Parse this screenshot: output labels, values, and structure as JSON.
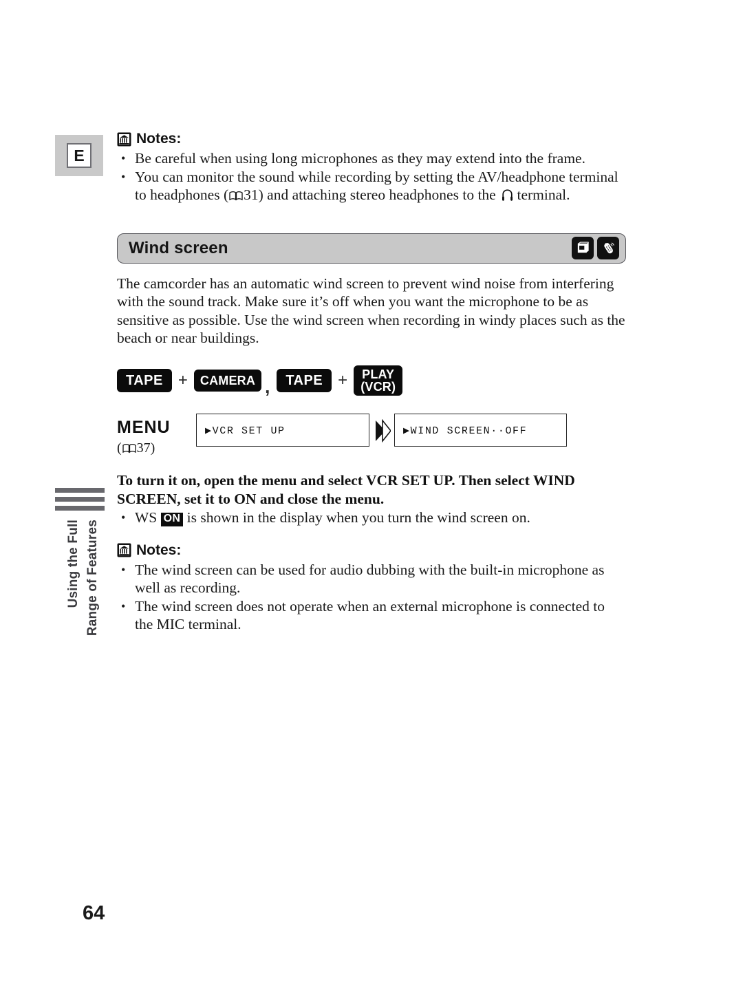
{
  "page": {
    "number": "64",
    "side_tab_letter": "E",
    "side_label_line1": "Using the Full",
    "side_label_line2": "Range of Features"
  },
  "notes_top": {
    "icon": "book-note-icon",
    "heading": "Notes:",
    "bullets": [
      {
        "parts": [
          {
            "type": "text",
            "value": "Be careful when using long microphones as they may extend into the frame."
          }
        ]
      },
      {
        "parts": [
          {
            "type": "text",
            "value": "You can monitor the sound while recording by setting the AV/headphone terminal to headphones ("
          },
          {
            "type": "pageref",
            "value": "31"
          },
          {
            "type": "text",
            "value": ") and attaching stereo headphones to the "
          },
          {
            "type": "headphone-symbol",
            "value": ""
          },
          {
            "type": "text",
            "value": " terminal."
          }
        ]
      }
    ]
  },
  "section": {
    "title": "Wind screen",
    "mode_icons": [
      {
        "name": "tape-cassette-icon",
        "label": "TAPE"
      },
      {
        "name": "remote-control-icon",
        "label": "REMOTE"
      }
    ],
    "body": "The camcorder has an automatic wind screen to prevent wind noise from interfering with the sound track. Make sure it’s off when you want the microphone to be as sensitive as possible. Use the wind screen when recording in windy places such as the beach or near buildings."
  },
  "mode_chips": {
    "group1": {
      "left": "TAPE",
      "plus": "+",
      "right": "CAMERA"
    },
    "separator": ",",
    "group2": {
      "left": "TAPE",
      "plus": "+",
      "right_line1": "PLAY",
      "right_line2": "(VCR)"
    }
  },
  "menu_flow": {
    "label": "MENU",
    "ref_open": "(",
    "ref_page": "37",
    "ref_close": ")",
    "step1": "▶VCR SET UP",
    "step2": "▶WIND SCREEN··OFF"
  },
  "instruction": {
    "bold_line1": "To turn it on, open the menu and select VCR SET UP. Then select WIND",
    "bold_line2": "SCREEN, set it to ON and close the menu.",
    "bullet_prefix": "WS",
    "bullet_badge": "ON",
    "bullet_suffix": "is shown in the display when you turn the wind screen on."
  },
  "notes_bottom": {
    "icon": "book-note-icon",
    "heading": "Notes:",
    "bullets": [
      "The wind screen can be used for audio dubbing with the built-in microphone as well as recording.",
      "The wind screen does not operate when an external microphone is connected to the MIC terminal."
    ]
  },
  "colors": {
    "header_bar": "#c8c8c8",
    "tab_block": "#c9c9c9",
    "side_bar": "#68686d",
    "chip_bg": "#0b0b0b",
    "text": "#1a1a1a"
  }
}
